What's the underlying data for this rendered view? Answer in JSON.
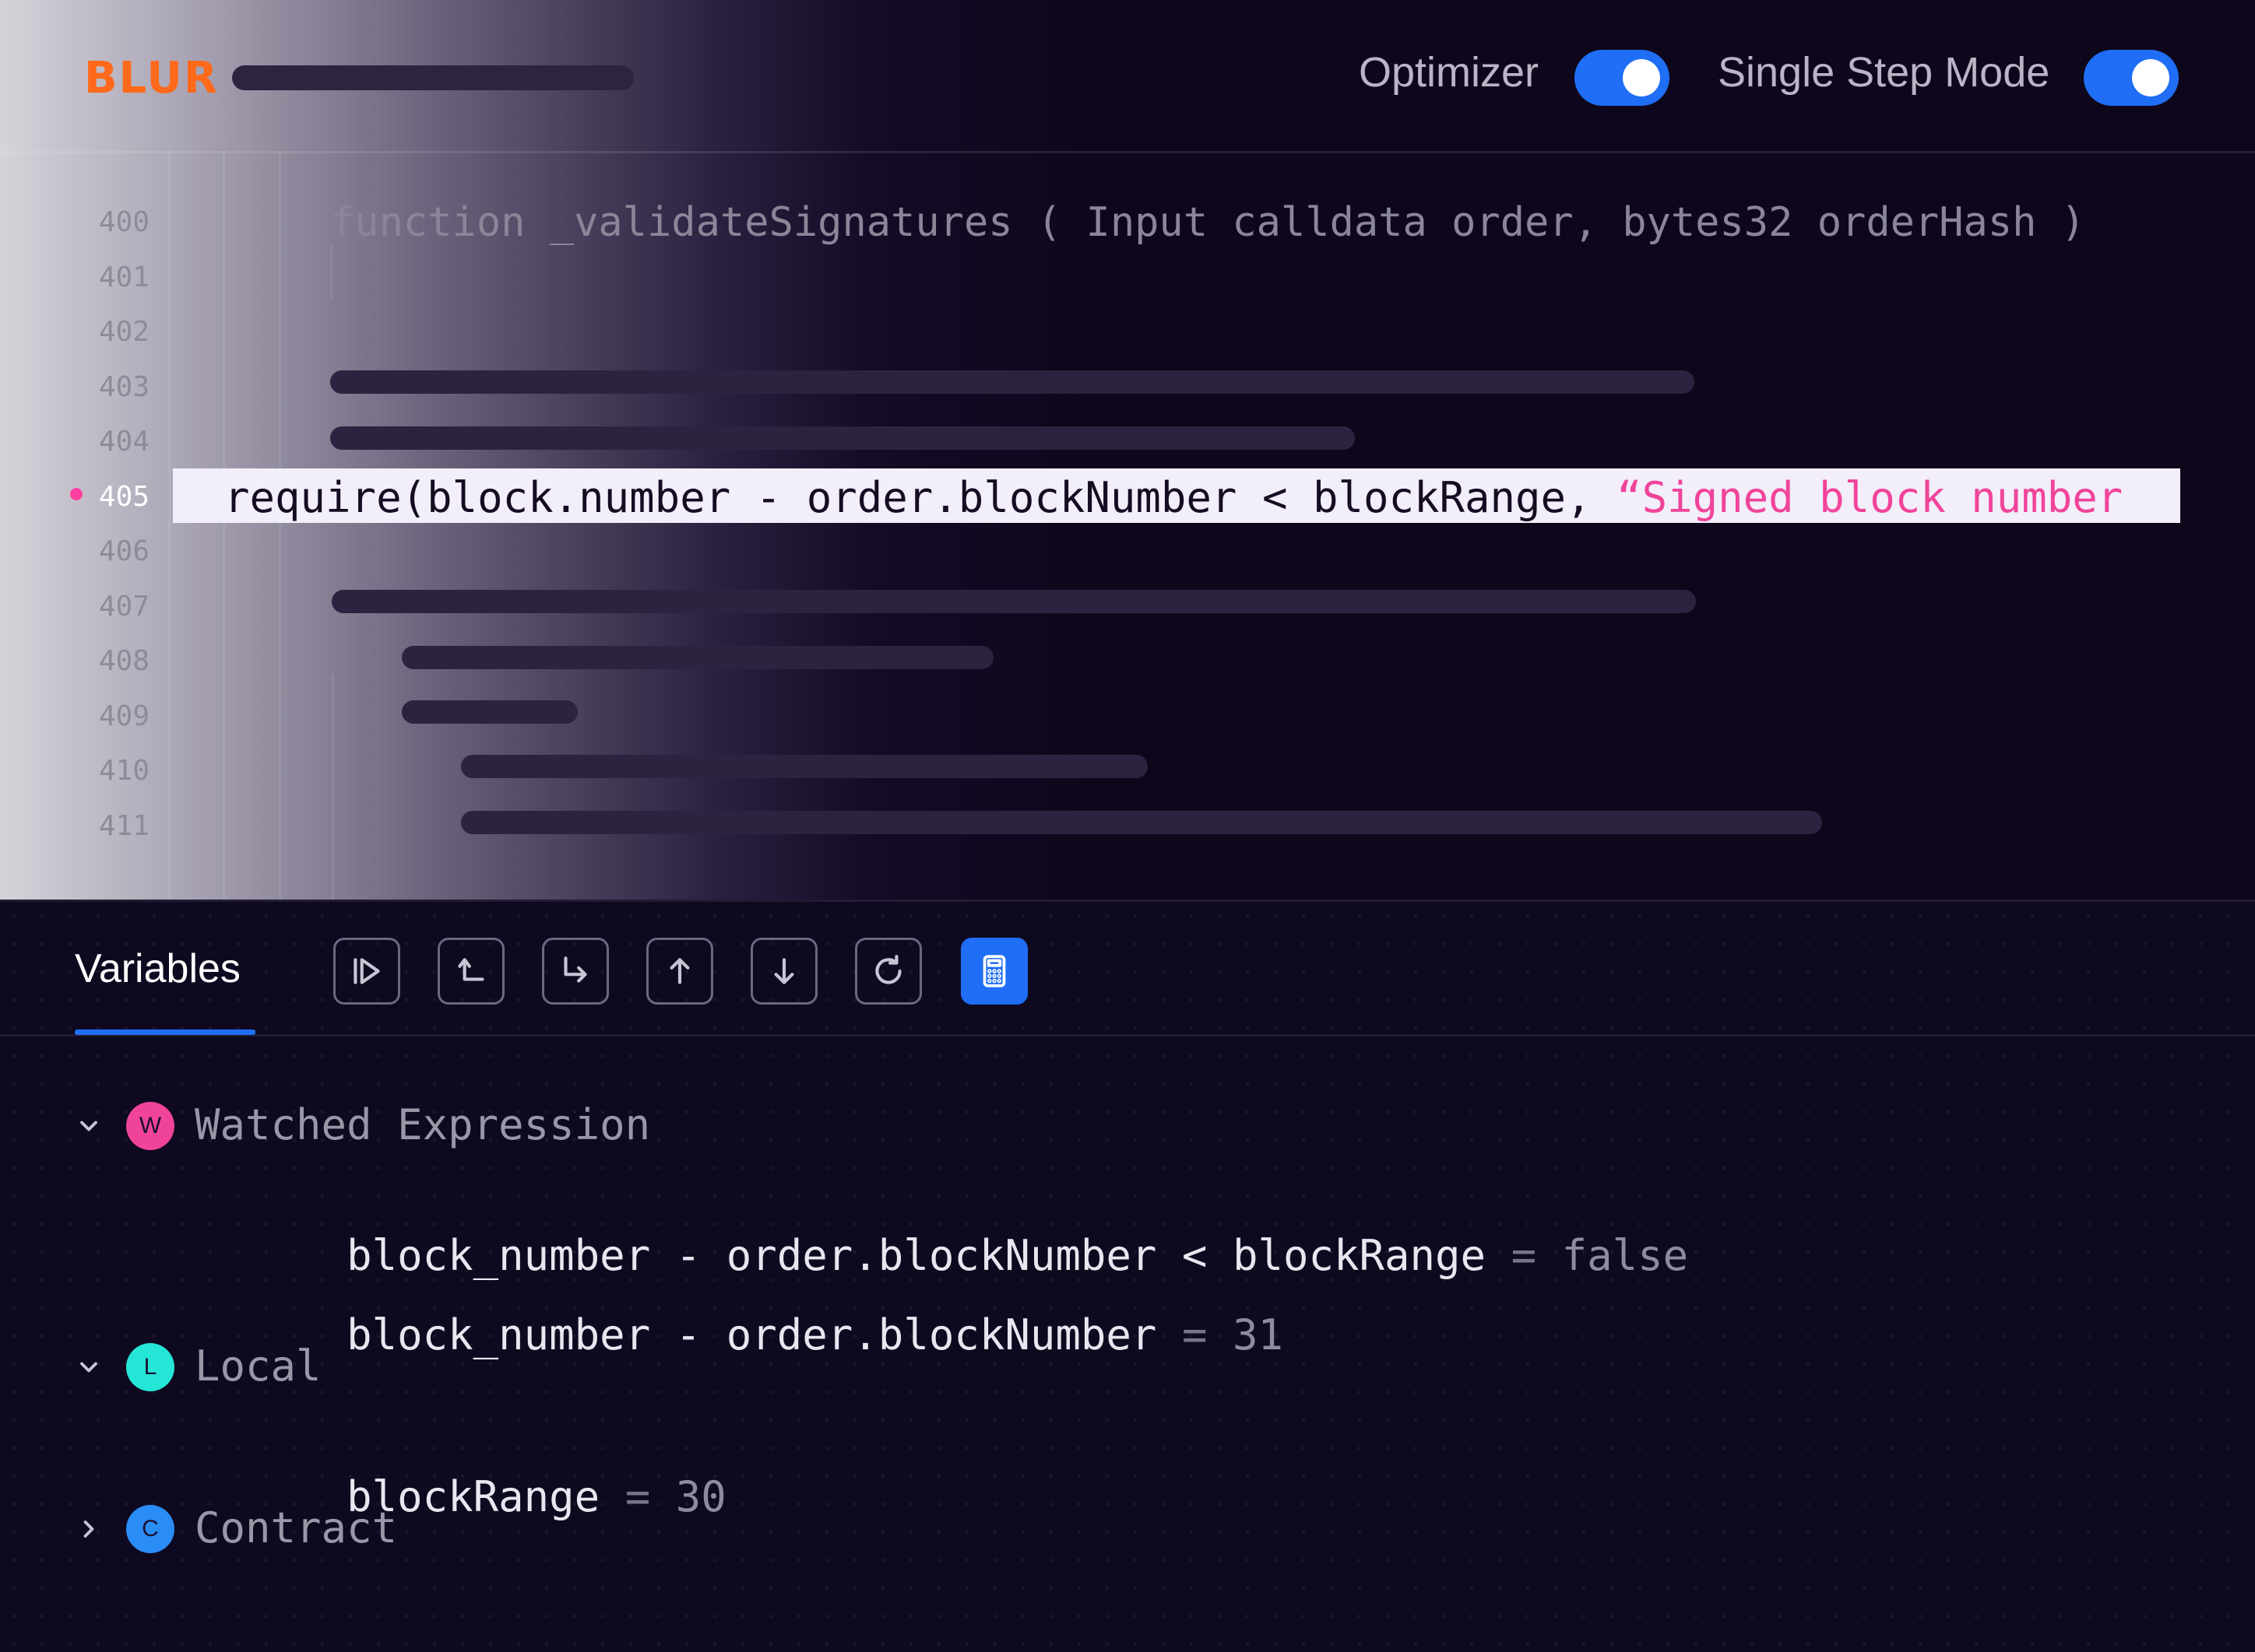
{
  "header": {
    "logo": "BLUR",
    "toggles": [
      {
        "label": "Optimizer",
        "state": "on"
      },
      {
        "label": "Single Step Mode",
        "state": "on"
      }
    ]
  },
  "editor": {
    "line_numbers": [
      "400",
      "401",
      "402",
      "403",
      "404",
      "405",
      "406",
      "407",
      "408",
      "409",
      "410",
      "411"
    ],
    "active_line": "405",
    "signature_line": "function _validateSignatures ( Input calldata order, bytes32 orderHash )",
    "highlighted_code": "require(block.number - order.blockNumber < blockRange, ",
    "highlighted_string": "“Signed block number"
  },
  "panel": {
    "tab": "Variables",
    "tools": [
      "step-into-icon",
      "step-back-icon",
      "step-over-icon",
      "step-up-icon",
      "step-down-icon",
      "restart-icon",
      "calculator-icon"
    ],
    "groups": [
      {
        "badge": "W",
        "label": "Watched Expression",
        "expanded": true,
        "color": "#f0449a",
        "items": [
          {
            "expr": "block_number - order.blockNumber < blockRange",
            "eq": "=",
            "value": "false"
          },
          {
            "expr": "block_number - order.blockNumber",
            "eq": "=",
            "value": "31"
          }
        ]
      },
      {
        "badge": "L",
        "label": "Local",
        "expanded": true,
        "color": "#25e6d6",
        "items": [
          {
            "expr": "blockRange",
            "eq": "=",
            "value": "30"
          }
        ]
      },
      {
        "badge": "C",
        "label": "Contract",
        "expanded": false,
        "color": "#2a8cf5",
        "items": []
      }
    ]
  },
  "colors": {
    "accent": "#1f6ef5",
    "logo": "#ff6a1a",
    "string": "#f0449a",
    "breakpoint": "#ff3fa0"
  }
}
